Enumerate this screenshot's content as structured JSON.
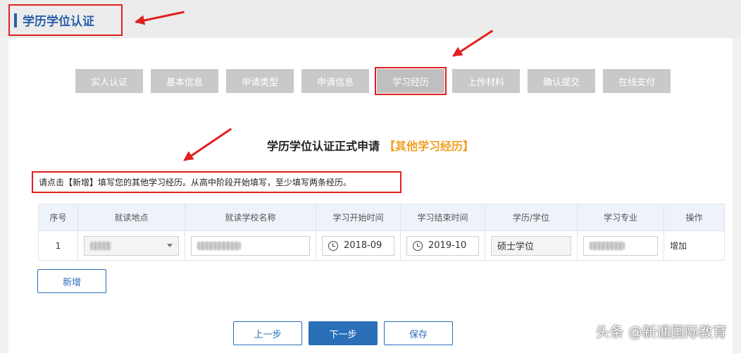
{
  "header": {
    "title": "学历学位认证"
  },
  "steps": [
    {
      "label": "实人认证",
      "active": false
    },
    {
      "label": "基本信息",
      "active": false
    },
    {
      "label": "申请类型",
      "active": false
    },
    {
      "label": "申请信息",
      "active": false
    },
    {
      "label": "学习经历",
      "active": true
    },
    {
      "label": "上传材料",
      "active": false
    },
    {
      "label": "确认提交",
      "active": false
    },
    {
      "label": "在线支付",
      "active": false
    }
  ],
  "form": {
    "heading": "学历学位认证正式申请",
    "subheading": "【其他学习经历】",
    "notice": "请点击【新增】填写您的其他学习经历。从高中阶段开始填写，至少填写两条经历。"
  },
  "table": {
    "columns": [
      "序号",
      "就读地点",
      "就读学校名称",
      "学习开始时间",
      "学习结束时间",
      "学历/学位",
      "学习专业",
      "操作"
    ],
    "rows": [
      {
        "index": "1",
        "start": "2018-09",
        "end": "2019-10",
        "degree": "硕士学位",
        "action": "增加"
      }
    ]
  },
  "buttons": {
    "add": "新增",
    "prev": "上一步",
    "next": "下一步",
    "save": "保存"
  },
  "watermark": "头条 @新通国际教育",
  "colors": {
    "accent": "#2a5fa8",
    "highlight": "#e02020",
    "sub_heading": "#f0a020",
    "step_bg": "#c9c9c9"
  }
}
